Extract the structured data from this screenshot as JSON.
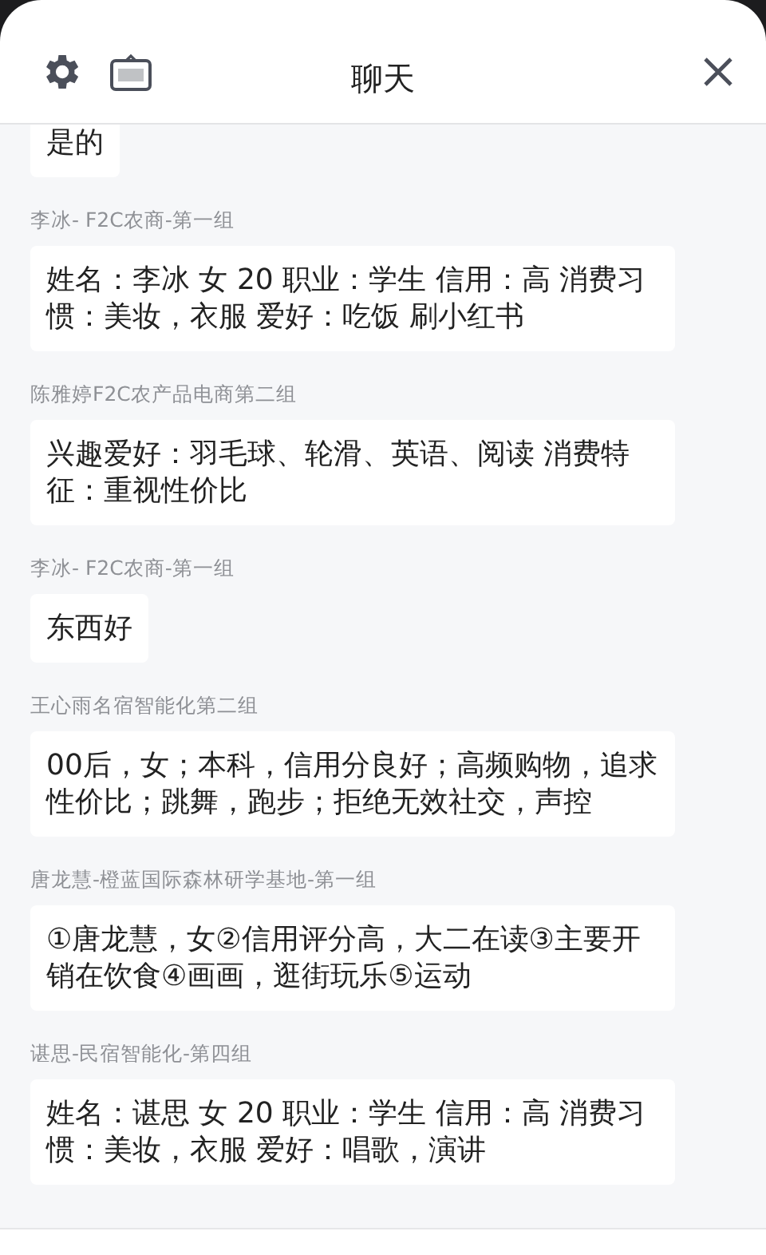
{
  "header": {
    "title": "聊天"
  },
  "messages": [
    {
      "text": "是的"
    },
    {
      "sender": "李冰- F2C农商-第一组",
      "text": "姓名：李冰 女 20 职业：学生 信用：高 消费习惯：美妆，衣服 爱好：吃饭 刷小红书"
    },
    {
      "sender": "陈雅婷F2C农产品电商第二组",
      "text": "兴趣爱好：羽毛球、轮滑、英语、阅读 消费特征：重视性价比"
    },
    {
      "sender": "李冰- F2C农商-第一组",
      "text": "东西好"
    },
    {
      "sender": "王心雨名宿智能化第二组",
      "text": "00后，女；本科，信用分良好；高频购物，追求性价比；跳舞，跑步；拒绝无效社交，声控"
    },
    {
      "sender": "唐龙慧-橙蓝国际森林研学基地-第一组",
      "text": "①唐龙慧，女②信用评分高，大二在读③主要开销在饮食④画画，逛街玩乐⑤运动"
    },
    {
      "sender": "谌思-民宿智能化-第四组",
      "text": "姓名：谌思 女 20 职业：学生 信用：高 消费习惯：美妆，衣服 爱好：唱歌，演讲"
    }
  ]
}
